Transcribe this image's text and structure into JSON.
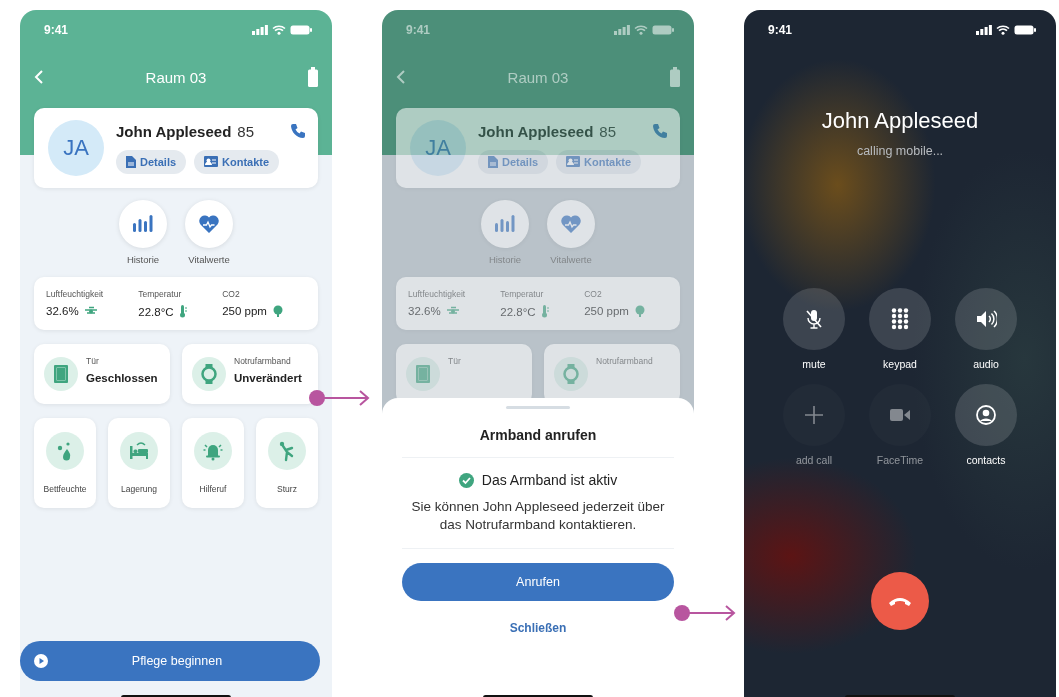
{
  "screens": [
    {
      "kind": "patient",
      "dimmed": false,
      "status_bar": {
        "time": "9:41"
      },
      "header": {
        "title": "Raum 03"
      },
      "patient": {
        "initials": "JA",
        "name": "John Appleseed",
        "age": "85",
        "buttons": [
          "Details",
          "Kontakte"
        ]
      },
      "quick_actions": [
        {
          "label": "Historie"
        },
        {
          "label": "Vitalwerte"
        }
      ],
      "sensors": [
        {
          "label": "Luftfeuchtigkeit",
          "value": "32.6%"
        },
        {
          "label": "Temperatur",
          "value": "22.8°C"
        },
        {
          "label": "CO2",
          "value": "250 ppm"
        }
      ],
      "status_tiles": [
        {
          "label": "Tür",
          "value": "Geschlossen"
        },
        {
          "label": "Notrufarmband",
          "value": "Unverändert"
        }
      ],
      "action_tiles": [
        {
          "label": "Bettfeuchte"
        },
        {
          "label": "Lagerung"
        },
        {
          "label": "Hilferuf"
        },
        {
          "label": "Sturz"
        }
      ],
      "primary_button": "Pflege beginnen"
    },
    {
      "kind": "patient",
      "dimmed": true,
      "status_bar": {
        "time": "9:41"
      },
      "header": {
        "title": "Raum 03"
      },
      "patient": {
        "initials": "JA",
        "name": "John Appleseed",
        "age": "85",
        "buttons": [
          "Details",
          "Kontakte"
        ]
      },
      "quick_actions": [
        {
          "label": "Historie"
        },
        {
          "label": "Vitalwerte"
        }
      ],
      "sensors": [
        {
          "label": "Luftfeuchtigkeit",
          "value": "32.6%"
        },
        {
          "label": "Temperatur",
          "value": "22.8°C"
        },
        {
          "label": "CO2",
          "value": "250 ppm"
        }
      ],
      "status_tiles": [
        {
          "label": "Tür"
        },
        {
          "label": "Notrufarmband"
        }
      ],
      "sheet": {
        "title": "Armband anrufen",
        "status": "Das Armband ist aktiv",
        "message": "Sie können John Appleseed jederzeit über das Notrufarmband kontaktieren.",
        "button": "Anrufen",
        "link": "Schließen"
      }
    },
    {
      "kind": "call",
      "status_bar": {
        "time": "9:41"
      },
      "caller": "John Appleseed",
      "subtitle": "calling mobile...",
      "controls": [
        {
          "label": "mute",
          "disabled": false
        },
        {
          "label": "keypad",
          "disabled": false
        },
        {
          "label": "audio",
          "disabled": false
        },
        {
          "label": "add call",
          "disabled": true
        },
        {
          "label": "FaceTime",
          "disabled": true
        },
        {
          "label": "contacts",
          "disabled": false
        }
      ]
    }
  ]
}
